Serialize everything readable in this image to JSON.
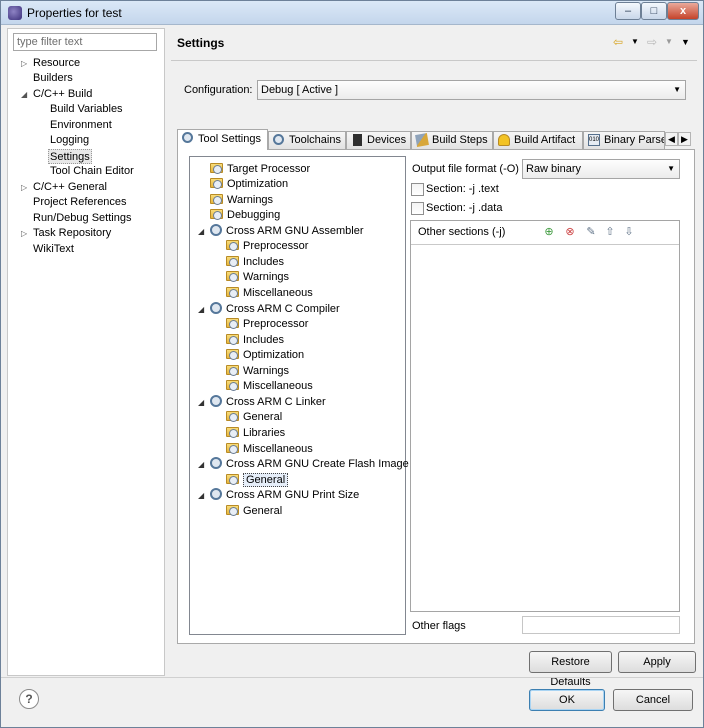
{
  "window": {
    "title": "Properties for test",
    "buttons": {
      "minimize": "–",
      "maximize": "□",
      "close": "x"
    }
  },
  "filter": {
    "placeholder": "type filter text"
  },
  "nav": {
    "items": [
      {
        "label": "Resource",
        "arrow": "▷"
      },
      {
        "label": "Builders",
        "arrow": ""
      },
      {
        "label": "C/C++ Build",
        "arrow": "◢"
      },
      {
        "label": "Build Variables",
        "arrow": ""
      },
      {
        "label": "Environment",
        "arrow": ""
      },
      {
        "label": "Logging",
        "arrow": ""
      },
      {
        "label": "Settings",
        "arrow": ""
      },
      {
        "label": "Tool Chain Editor",
        "arrow": ""
      },
      {
        "label": "C/C++ General",
        "arrow": "▷"
      },
      {
        "label": "Project References",
        "arrow": ""
      },
      {
        "label": "Run/Debug Settings",
        "arrow": ""
      },
      {
        "label": "Task Repository",
        "arrow": "▷"
      },
      {
        "label": "WikiText",
        "arrow": ""
      }
    ]
  },
  "header": {
    "title": "Settings",
    "icons": [
      "back-arrow-icon",
      "forward-arrow-icon",
      "view-menu-icon"
    ]
  },
  "configuration": {
    "label": "Configuration:",
    "value": "Debug  [ Active ]"
  },
  "tabs": [
    {
      "label": "Tool Settings",
      "icon": "tool-settings-icon"
    },
    {
      "label": "Toolchains",
      "icon": "toolchains-icon"
    },
    {
      "label": "Devices",
      "icon": "devices-icon"
    },
    {
      "label": "Build Steps",
      "icon": "build-steps-icon"
    },
    {
      "label": "Build Artifact",
      "icon": "build-artifact-icon"
    },
    {
      "label": "Binary Parser",
      "icon": "binary-parser-icon"
    }
  ],
  "tree": [
    {
      "label": "Target Processor"
    },
    {
      "label": "Optimization"
    },
    {
      "label": "Warnings"
    },
    {
      "label": "Debugging"
    },
    {
      "label": "Cross ARM GNU Assembler"
    },
    {
      "label": "Preprocessor"
    },
    {
      "label": "Includes"
    },
    {
      "label": "Warnings"
    },
    {
      "label": "Miscellaneous"
    },
    {
      "label": "Cross ARM C Compiler"
    },
    {
      "label": "Preprocessor"
    },
    {
      "label": "Includes"
    },
    {
      "label": "Optimization"
    },
    {
      "label": "Warnings"
    },
    {
      "label": "Miscellaneous"
    },
    {
      "label": "Cross ARM C Linker"
    },
    {
      "label": "General"
    },
    {
      "label": "Libraries"
    },
    {
      "label": "Miscellaneous"
    },
    {
      "label": "Cross ARM GNU Create Flash Image"
    },
    {
      "label": "General"
    },
    {
      "label": "Cross ARM GNU Print Size"
    },
    {
      "label": "General"
    }
  ],
  "options": {
    "output_format_label": "Output file format (-O)",
    "output_format_value": "Raw binary",
    "section_text_label": "Section: -j .text",
    "section_data_label": "Section: -j .data",
    "other_sections_label": "Other sections (-j)",
    "other_flags_label": "Other flags"
  },
  "buttons": {
    "restore_defaults": "Restore Defaults",
    "apply": "Apply",
    "ok": "OK",
    "cancel": "Cancel",
    "help": "?"
  }
}
